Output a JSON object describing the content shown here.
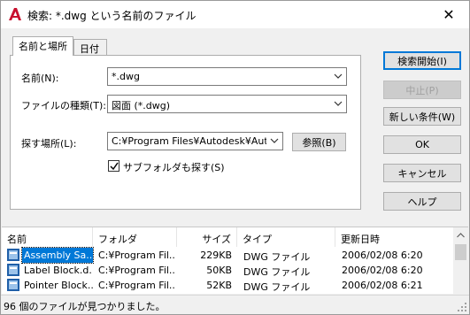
{
  "window": {
    "title": "検索: *.dwg という名前のファイル",
    "close_glyph": "✕"
  },
  "tabs": [
    {
      "label": "名前と場所"
    },
    {
      "label": "日付"
    }
  ],
  "form": {
    "name_label": "名前(N):",
    "name_value": "*.dwg",
    "type_label": "ファイルの種類(T):",
    "type_value": "図面 (*.dwg)",
    "search_in_label": "探す場所(L):",
    "search_in_value": "C:¥Program Files¥Autodesk¥AutoC",
    "browse_label": "参照(B)",
    "subfolders_label": "サブフォルダも探す(S)",
    "subfolders_checked": true
  },
  "buttons": {
    "find_now": "検索開始(I)",
    "stop": "中止(P)",
    "new_search": "新しい条件(W)",
    "ok": "OK",
    "cancel": "キャンセル",
    "help": "ヘルプ"
  },
  "results": {
    "columns": [
      "名前",
      "フォルダ",
      "サイズ",
      "タイプ",
      "更新日時"
    ],
    "rows": [
      {
        "name": "Assembly Sa...",
        "folder": "C:¥Program Fil...",
        "size": "229KB",
        "type": "DWG ファイル",
        "modified": "2006/02/08 6:20",
        "selected": true
      },
      {
        "name": "Label Block.d...",
        "folder": "C:¥Program Fil...",
        "size": "50KB",
        "type": "DWG ファイル",
        "modified": "2006/02/08 6:20",
        "selected": false
      },
      {
        "name": "Pointer Block...",
        "folder": "C:¥Program Fil...",
        "size": "52KB",
        "type": "DWG ファイル",
        "modified": "2006/02/08 6:21",
        "selected": false
      }
    ]
  },
  "status": {
    "text": "96 個のファイルが見つかりました。"
  },
  "colors": {
    "accent": "#0078d7",
    "app_icon": "#c8102e"
  }
}
